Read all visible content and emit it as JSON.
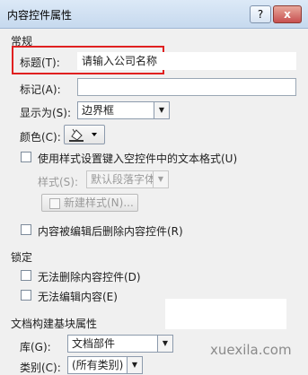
{
  "window": {
    "title": "内容控件属性",
    "help": "?",
    "close": "x"
  },
  "general": {
    "section": "常规",
    "title_label": "标题(T):",
    "title_value": "请输入公司名称",
    "tag_label": "标记(A):",
    "tag_value": "",
    "showas_label": "显示为(S):",
    "showas_value": "边界框",
    "color_label": "颜色(C):",
    "use_style_label": "使用样式设置键入空控件中的文本格式(U)",
    "style_label": "样式(S):",
    "style_value": "默认段落字体",
    "new_style_label": "新建样式(N)...",
    "remove_label": "内容被编辑后删除内容控件(R)"
  },
  "locking": {
    "section": "锁定",
    "no_delete": "无法删除内容控件(D)",
    "no_edit": "无法编辑内容(E)"
  },
  "building_block": {
    "section": "文档构建基块属性",
    "gallery_label": "库(G):",
    "gallery_value": "文档部件",
    "category_label": "类别(C):",
    "category_value": "(所有类别)"
  },
  "watermark": "xuexila.com",
  "colors": {
    "highlight": "#e02020"
  }
}
